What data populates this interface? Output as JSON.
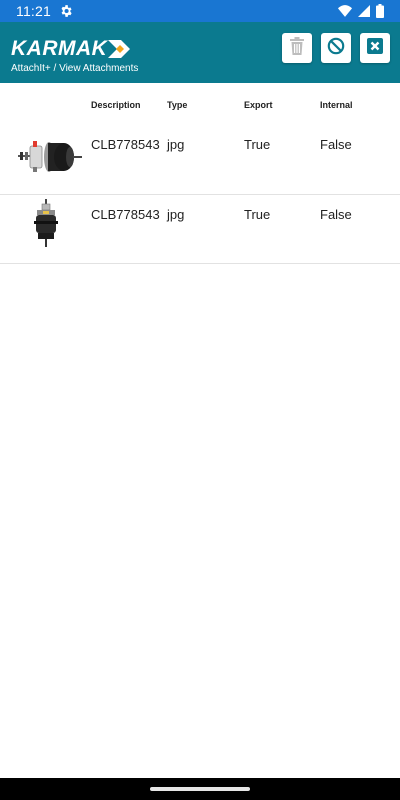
{
  "status_bar": {
    "time": "11:21",
    "icons": [
      "gear-icon",
      "wifi-icon",
      "signal-icon",
      "battery-icon"
    ]
  },
  "header": {
    "logo_text": "KARMAK",
    "breadcrumb": "AttachIt+ / View Attachments",
    "actions": [
      {
        "name": "delete",
        "icon": "trash-icon"
      },
      {
        "name": "cancel",
        "icon": "block-icon"
      },
      {
        "name": "close",
        "icon": "close-box-icon"
      }
    ],
    "colors": {
      "header_bg": "#0b7a8f",
      "status_bg": "#1976d2",
      "logo_accent": "#f4a51c"
    }
  },
  "table": {
    "columns": {
      "description": "Description",
      "type": "Type",
      "export": "Export",
      "internal": "Internal"
    },
    "rows": [
      {
        "thumbnail": "brake-chamber-side-view",
        "description": "CLB778543",
        "type": "jpg",
        "export": "True",
        "internal": "False"
      },
      {
        "thumbnail": "brake-chamber-front-view",
        "description": "CLB778543",
        "type": "jpg",
        "export": "True",
        "internal": "False"
      }
    ]
  }
}
